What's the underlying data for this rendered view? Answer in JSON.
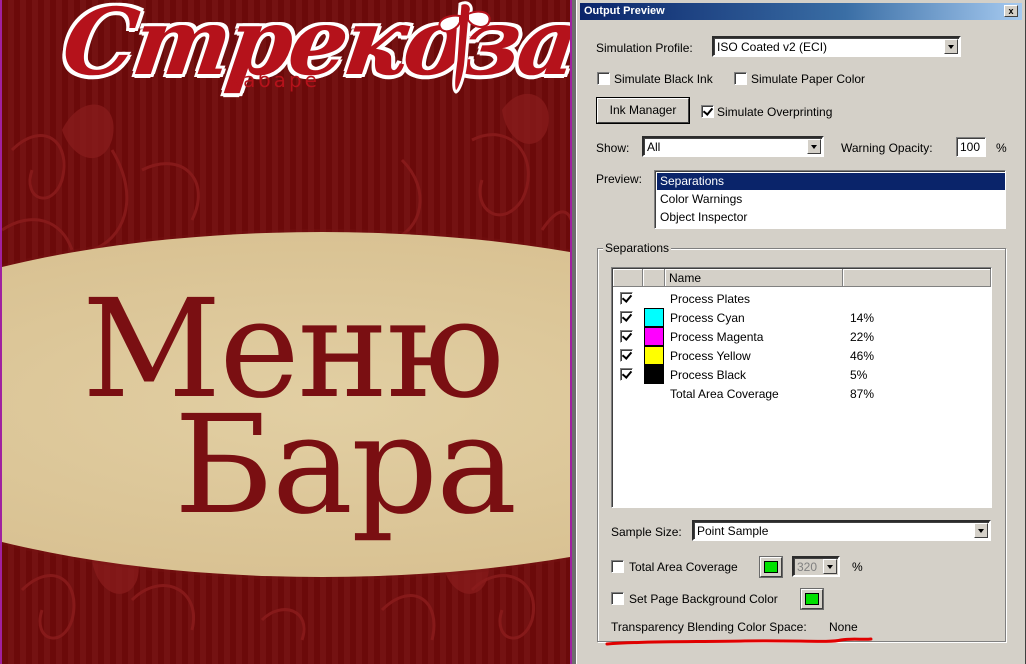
{
  "document": {
    "logo_text": "Стрекоза",
    "logo_subtitle": "кабаре",
    "menu_line1": "Меню",
    "menu_line2": "Бара"
  },
  "dialog": {
    "title": "Output Preview",
    "close_symbol": "x",
    "simulation_profile_label": "Simulation Profile:",
    "simulation_profile_value": "ISO Coated v2 (ECI)",
    "simulate_black_ink_label": "Simulate Black Ink",
    "simulate_black_ink_checked": false,
    "simulate_paper_color_label": "Simulate Paper Color",
    "simulate_paper_color_checked": false,
    "ink_manager_label": "Ink Manager",
    "simulate_overprinting_label": "Simulate Overprinting",
    "simulate_overprinting_checked": true,
    "show_label": "Show:",
    "show_value": "All",
    "warning_opacity_label": "Warning Opacity:",
    "warning_opacity_value": "100",
    "warning_opacity_unit": "%",
    "preview_label": "Preview:",
    "preview_items": [
      "Separations",
      "Color Warnings",
      "Object Inspector"
    ],
    "preview_selected": "Separations",
    "separations_group_label": "Separations",
    "table_header_name": "Name",
    "separations": [
      {
        "name": "Process Plates",
        "checked": true,
        "color": "",
        "percent": ""
      },
      {
        "name": "Process Cyan",
        "checked": true,
        "color": "#00ffff",
        "percent": "14%"
      },
      {
        "name": "Process Magenta",
        "checked": true,
        "color": "#ff00ff",
        "percent": "22%"
      },
      {
        "name": "Process Yellow",
        "checked": true,
        "color": "#ffff00",
        "percent": "46%"
      },
      {
        "name": "Process Black",
        "checked": true,
        "color": "#000000",
        "percent": "5%"
      },
      {
        "name": "Total Area Coverage",
        "checked": null,
        "color": "",
        "percent": "87%"
      }
    ],
    "sample_size_label": "Sample Size:",
    "sample_size_value": "Point Sample",
    "total_area_coverage_label": "Total Area Coverage",
    "total_area_coverage_checked": false,
    "total_area_coverage_value": "320",
    "total_area_coverage_unit": "%",
    "set_page_bg_label": "Set Page Background Color",
    "set_page_bg_checked": false,
    "swatch_color": "#00e000",
    "transparency_label": "Transparency Blending Color Space:",
    "transparency_value": "None"
  }
}
